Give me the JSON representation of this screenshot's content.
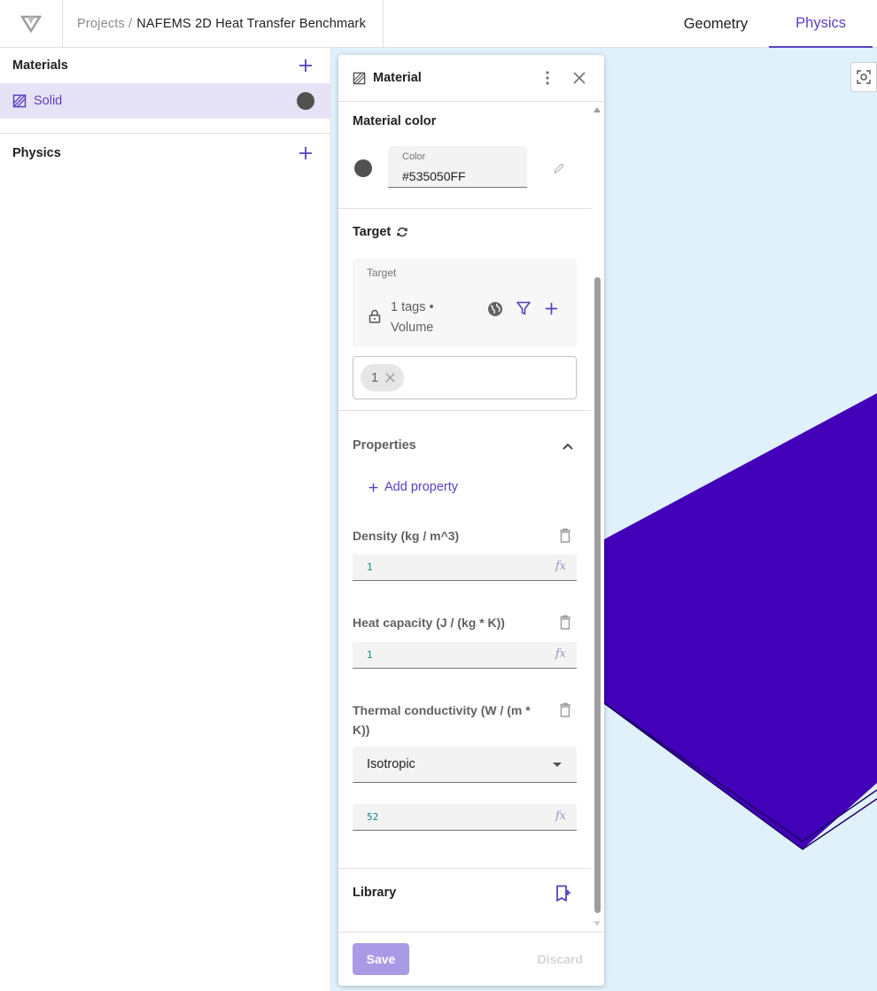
{
  "breadcrumb": {
    "root": "Projects",
    "separator": "/",
    "project": "NAFEMS 2D Heat Transfer Benchmark"
  },
  "tabs": [
    {
      "label": "Geometry",
      "active": false
    },
    {
      "label": "Physics",
      "active": true
    }
  ],
  "sidebar": {
    "materials": {
      "title": "Materials",
      "items": [
        {
          "label": "Solid",
          "color": "#535050"
        }
      ]
    },
    "physics": {
      "title": "Physics"
    }
  },
  "panel": {
    "title": "Material",
    "material_color": {
      "title": "Material color",
      "field_label": "Color",
      "value": "#535050FF",
      "swatch": "#535050"
    },
    "target": {
      "title": "Target",
      "box_label": "Target",
      "summary": "1 tags • Volume",
      "chips": [
        "1"
      ]
    },
    "properties": {
      "title": "Properties",
      "add_label": "Add property",
      "items": [
        {
          "label": "Density (kg / m^3)",
          "value": "1"
        },
        {
          "label": "Heat capacity (J / (kg * K))",
          "value": "1"
        },
        {
          "label": "Thermal conductivity (W / (m * K))",
          "type": "Isotropic",
          "value": "52"
        }
      ]
    },
    "library": {
      "title": "Library"
    },
    "footer": {
      "save": "Save",
      "discard": "Discard"
    }
  },
  "colors": {
    "accent": "#5a3fc0",
    "selected_bg": "#e7e3f7",
    "viewport_bg": "#e1f1fc",
    "shape": "#4200b8"
  }
}
